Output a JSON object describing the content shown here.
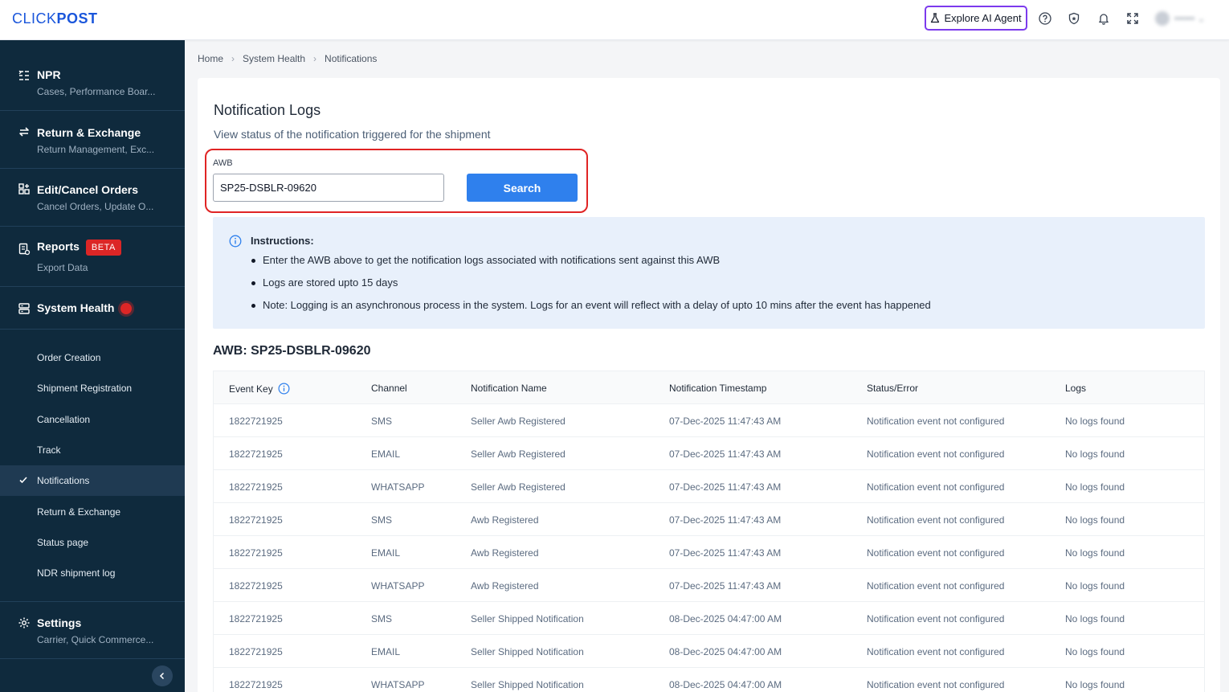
{
  "header": {
    "logo_bold": "CLICK",
    "logo_rest": "POST",
    "explore_label": "Explore AI Agent"
  },
  "sidebar": {
    "sections": [
      {
        "title": "NPR",
        "subtitle": "Cases, Performance Boar...",
        "icon": "list-filter-icon"
      },
      {
        "title": "Return & Exchange",
        "subtitle": "Return Management, Exc...",
        "icon": "swap-icon"
      },
      {
        "title": "Edit/Cancel Orders",
        "subtitle": "Cancel Orders, Update O...",
        "icon": "grid-plus-icon"
      },
      {
        "title": "Reports",
        "badge": "BETA",
        "subtitle": "Export Data",
        "icon": "report-icon"
      },
      {
        "title": "System Health",
        "icon": "server-icon"
      },
      {
        "title": "Settings",
        "subtitle": "Carrier, Quick Commerce...",
        "icon": "gear-icon"
      }
    ],
    "submenu": [
      "Order Creation",
      "Shipment Registration",
      "Cancellation",
      "Track",
      "Notifications",
      "Return & Exchange",
      "Status page",
      "NDR shipment log"
    ],
    "active_submenu": "Notifications"
  },
  "breadcrumb": [
    "Home",
    "System Health",
    "Notifications"
  ],
  "main": {
    "title": "Notification Logs",
    "subtitle": "View status of the notification triggered for the shipment",
    "awb_label": "AWB",
    "awb_value": "SP25-DSBLR-09620",
    "search_label": "Search",
    "instructions_title": "Instructions:",
    "instructions": [
      "Enter the AWB above to get the notification logs associated with notifications sent against this AWB",
      "Logs are stored upto 15 days",
      "Note: Logging is an asynchronous process in the system. Logs for an event will reflect with a delay of upto 10 mins after the event has happened"
    ],
    "result_title": "AWB: SP25-DSBLR-09620"
  },
  "table": {
    "columns": [
      "Event Key",
      "Channel",
      "Notification Name",
      "Notification Timestamp",
      "Status/Error",
      "Logs"
    ],
    "rows": [
      [
        "1822721925",
        "SMS",
        "Seller Awb Registered",
        "07-Dec-2025 11:47:43 AM",
        "Notification event not configured",
        "No logs found"
      ],
      [
        "1822721925",
        "EMAIL",
        "Seller Awb Registered",
        "07-Dec-2025 11:47:43 AM",
        "Notification event not configured",
        "No logs found"
      ],
      [
        "1822721925",
        "WHATSAPP",
        "Seller Awb Registered",
        "07-Dec-2025 11:47:43 AM",
        "Notification event not configured",
        "No logs found"
      ],
      [
        "1822721925",
        "SMS",
        "Awb Registered",
        "07-Dec-2025 11:47:43 AM",
        "Notification event not configured",
        "No logs found"
      ],
      [
        "1822721925",
        "EMAIL",
        "Awb Registered",
        "07-Dec-2025 11:47:43 AM",
        "Notification event not configured",
        "No logs found"
      ],
      [
        "1822721925",
        "WHATSAPP",
        "Awb Registered",
        "07-Dec-2025 11:47:43 AM",
        "Notification event not configured",
        "No logs found"
      ],
      [
        "1822721925",
        "SMS",
        "Seller Shipped Notification",
        "08-Dec-2025 04:47:00 AM",
        "Notification event not configured",
        "No logs found"
      ],
      [
        "1822721925",
        "EMAIL",
        "Seller Shipped Notification",
        "08-Dec-2025 04:47:00 AM",
        "Notification event not configured",
        "No logs found"
      ],
      [
        "1822721925",
        "WHATSAPP",
        "Seller Shipped Notification",
        "08-Dec-2025 04:47:00 AM",
        "Notification event not configured",
        "No logs found"
      ]
    ]
  },
  "colors": {
    "sidebar_bg": "#0f2a3d",
    "brand_blue": "#1a56db",
    "primary_button": "#2f80ed",
    "highlight_red": "#e02424",
    "ai_agent_border": "#7c3aed"
  }
}
